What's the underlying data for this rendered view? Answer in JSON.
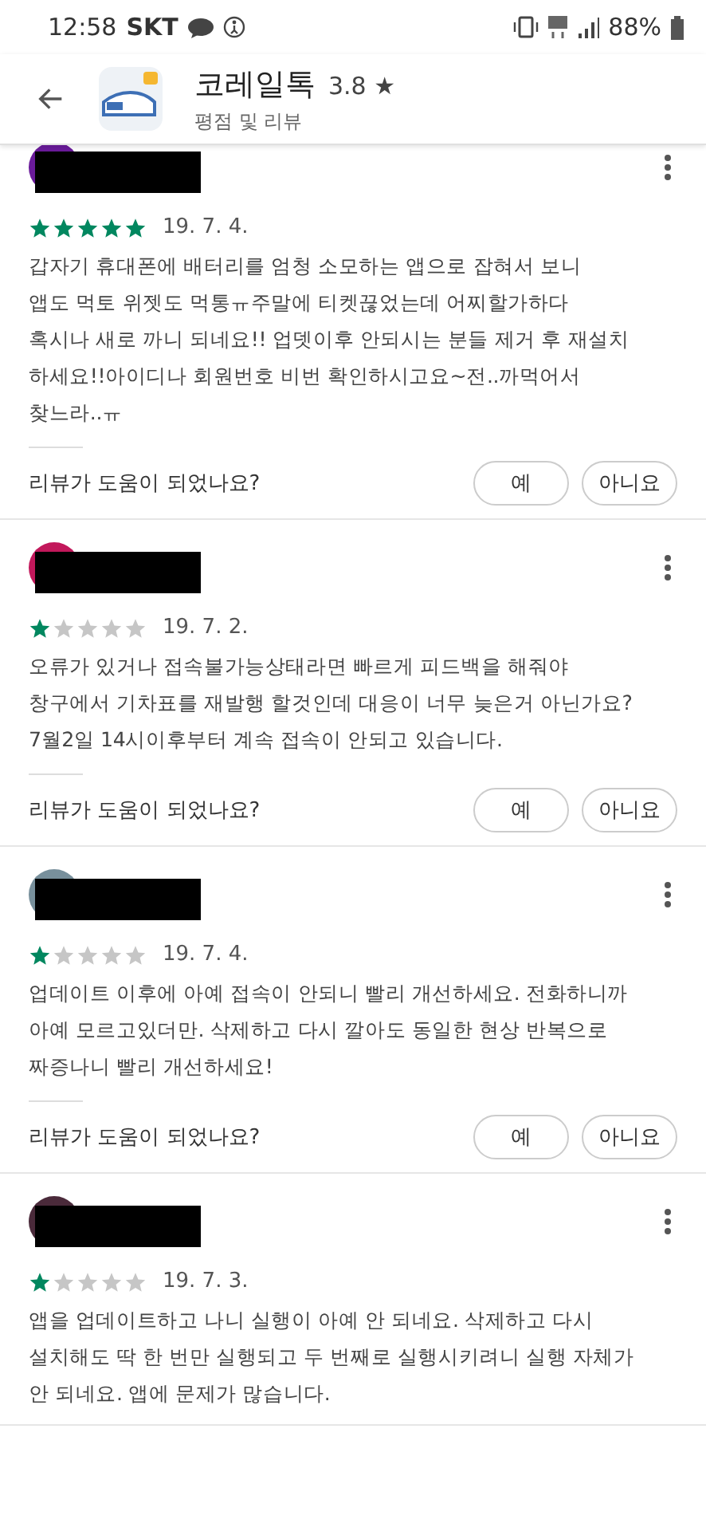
{
  "status_bar": {
    "time": "12:58",
    "carrier": "SKT",
    "battery": "88%"
  },
  "app_bar": {
    "app_name": "코레일톡",
    "rating": "3.8",
    "star": "★",
    "subtitle": "평점 및 리뷰"
  },
  "reviews": [
    {
      "color": "#6a1b9a",
      "stars": 5,
      "date": "19. 7. 4.",
      "text": "갑자기 휴대폰에 배터리를 엄청 소모하는 앱으로 잡혀서 보니\n앱도 먹토 위젯도 먹통ㅠ주말에 티켓끊었는데 어찌할가하다\n혹시나 새로 까니 되네요!! 업뎃이후 안되시는 분들 제거 후 재설치\n하세요!!아이디나 회원번호 비번 확인하시고요~전..까먹어서\n찾느라..ㅠ",
      "helpful": "리뷰가 도움이 되었나요?",
      "yes": "예",
      "no": "아니요"
    },
    {
      "color": "#c2185b",
      "stars": 1,
      "date": "19. 7. 2.",
      "text": "오류가 있거나 접속불가능상태라면 빠르게 피드백을 해줘야\n창구에서 기차표를 재발행 할것인데 대응이 너무 늦은거 아닌가요?\n7월2일 14시이후부터 계속 접속이 안되고 있습니다.",
      "helpful": "리뷰가 도움이 되었나요?",
      "yes": "예",
      "no": "아니요"
    },
    {
      "color": "#78909c",
      "stars": 1,
      "date": "19. 7. 4.",
      "text": "업데이트 이후에 아예 접속이 안되니 빨리 개선하세요. 전화하니까\n아예 모르고있더만. 삭제하고 다시 깔아도 동일한 현상 반복으로\n짜증나니 빨리 개선하세요!",
      "helpful": "리뷰가 도움이 되었나요?",
      "yes": "예",
      "no": "아니요"
    },
    {
      "color": "#4a2a3a",
      "stars": 1,
      "date": "19. 7. 3.",
      "text": "앱을 업데이트하고 나니 실행이 아예 안 되네요. 삭제하고 다시\n설치해도 딱 한 번만 실행되고 두 번째로 실행시키려니 실행 자체가\n안 되네요. 앱에 문제가 많습니다."
    }
  ]
}
